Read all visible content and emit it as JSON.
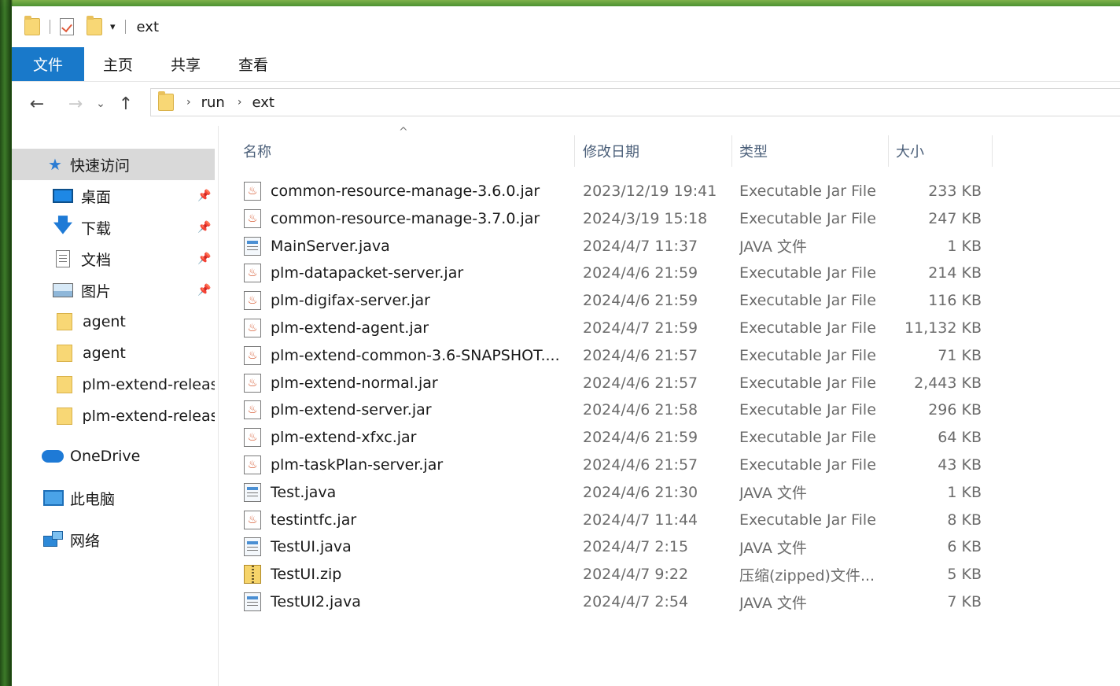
{
  "window": {
    "title": "ext"
  },
  "quick_access_toolbar": {
    "dropdown_glyph": "▾"
  },
  "ribbon": {
    "tabs": [
      "文件",
      "主页",
      "共享",
      "查看"
    ]
  },
  "nav": {
    "back": "←",
    "forward": "→",
    "recent": "⌄",
    "up": "↑",
    "breadcrumbs": [
      "run",
      "ext"
    ],
    "crumb_sep": "›"
  },
  "sidebar": {
    "quick_access": "快速访问",
    "pin_glyph": "📌",
    "items": [
      {
        "label": "桌面",
        "icon": "desktop-icon",
        "pinned": true
      },
      {
        "label": "下载",
        "icon": "download-icon",
        "pinned": true
      },
      {
        "label": "文档",
        "icon": "document-icon",
        "pinned": true
      },
      {
        "label": "图片",
        "icon": "pictures-icon",
        "pinned": true
      },
      {
        "label": "agent",
        "icon": "folder-icon",
        "pinned": false
      },
      {
        "label": "agent",
        "icon": "folder-icon",
        "pinned": false
      },
      {
        "label": "plm-extend-releas",
        "icon": "folder-icon",
        "pinned": false
      },
      {
        "label": "plm-extend-releas",
        "icon": "folder-icon",
        "pinned": false
      }
    ],
    "onedrive": "OneDrive",
    "this_pc": "此电脑",
    "network": "网络"
  },
  "columns": {
    "name": "名称",
    "modified": "修改日期",
    "type": "类型",
    "size": "大小",
    "sort_glyph": "^"
  },
  "files": [
    {
      "name": "common-resource-manage-3.6.0.jar",
      "modified": "2023/12/19 19:41",
      "type": "Executable Jar File",
      "size": "233 KB",
      "icon": "jar"
    },
    {
      "name": "common-resource-manage-3.7.0.jar",
      "modified": "2024/3/19 15:18",
      "type": "Executable Jar File",
      "size": "247 KB",
      "icon": "jar"
    },
    {
      "name": "MainServer.java",
      "modified": "2024/4/7 11:37",
      "type": "JAVA 文件",
      "size": "1 KB",
      "icon": "java"
    },
    {
      "name": "plm-datapacket-server.jar",
      "modified": "2024/4/6 21:59",
      "type": "Executable Jar File",
      "size": "214 KB",
      "icon": "jar"
    },
    {
      "name": "plm-digifax-server.jar",
      "modified": "2024/4/6 21:59",
      "type": "Executable Jar File",
      "size": "116 KB",
      "icon": "jar"
    },
    {
      "name": "plm-extend-agent.jar",
      "modified": "2024/4/7 21:59",
      "type": "Executable Jar File",
      "size": "11,132 KB",
      "icon": "jar"
    },
    {
      "name": "plm-extend-common-3.6-SNAPSHOT....",
      "modified": "2024/4/6 21:57",
      "type": "Executable Jar File",
      "size": "71 KB",
      "icon": "jar"
    },
    {
      "name": "plm-extend-normal.jar",
      "modified": "2024/4/6 21:57",
      "type": "Executable Jar File",
      "size": "2,443 KB",
      "icon": "jar"
    },
    {
      "name": "plm-extend-server.jar",
      "modified": "2024/4/6 21:58",
      "type": "Executable Jar File",
      "size": "296 KB",
      "icon": "jar"
    },
    {
      "name": "plm-extend-xfxc.jar",
      "modified": "2024/4/6 21:59",
      "type": "Executable Jar File",
      "size": "64 KB",
      "icon": "jar"
    },
    {
      "name": "plm-taskPlan-server.jar",
      "modified": "2024/4/6 21:57",
      "type": "Executable Jar File",
      "size": "43 KB",
      "icon": "jar"
    },
    {
      "name": "Test.java",
      "modified": "2024/4/6 21:30",
      "type": "JAVA 文件",
      "size": "1 KB",
      "icon": "java"
    },
    {
      "name": "testintfc.jar",
      "modified": "2024/4/7 11:44",
      "type": "Executable Jar File",
      "size": "8 KB",
      "icon": "jar"
    },
    {
      "name": "TestUI.java",
      "modified": "2024/4/7 2:15",
      "type": "JAVA 文件",
      "size": "6 KB",
      "icon": "java"
    },
    {
      "name": "TestUI.zip",
      "modified": "2024/4/7 9:22",
      "type": "压缩(zipped)文件...",
      "size": "5 KB",
      "icon": "zip"
    },
    {
      "name": "TestUI2.java",
      "modified": "2024/4/7 2:54",
      "type": "JAVA 文件",
      "size": "7 KB",
      "icon": "java"
    }
  ]
}
